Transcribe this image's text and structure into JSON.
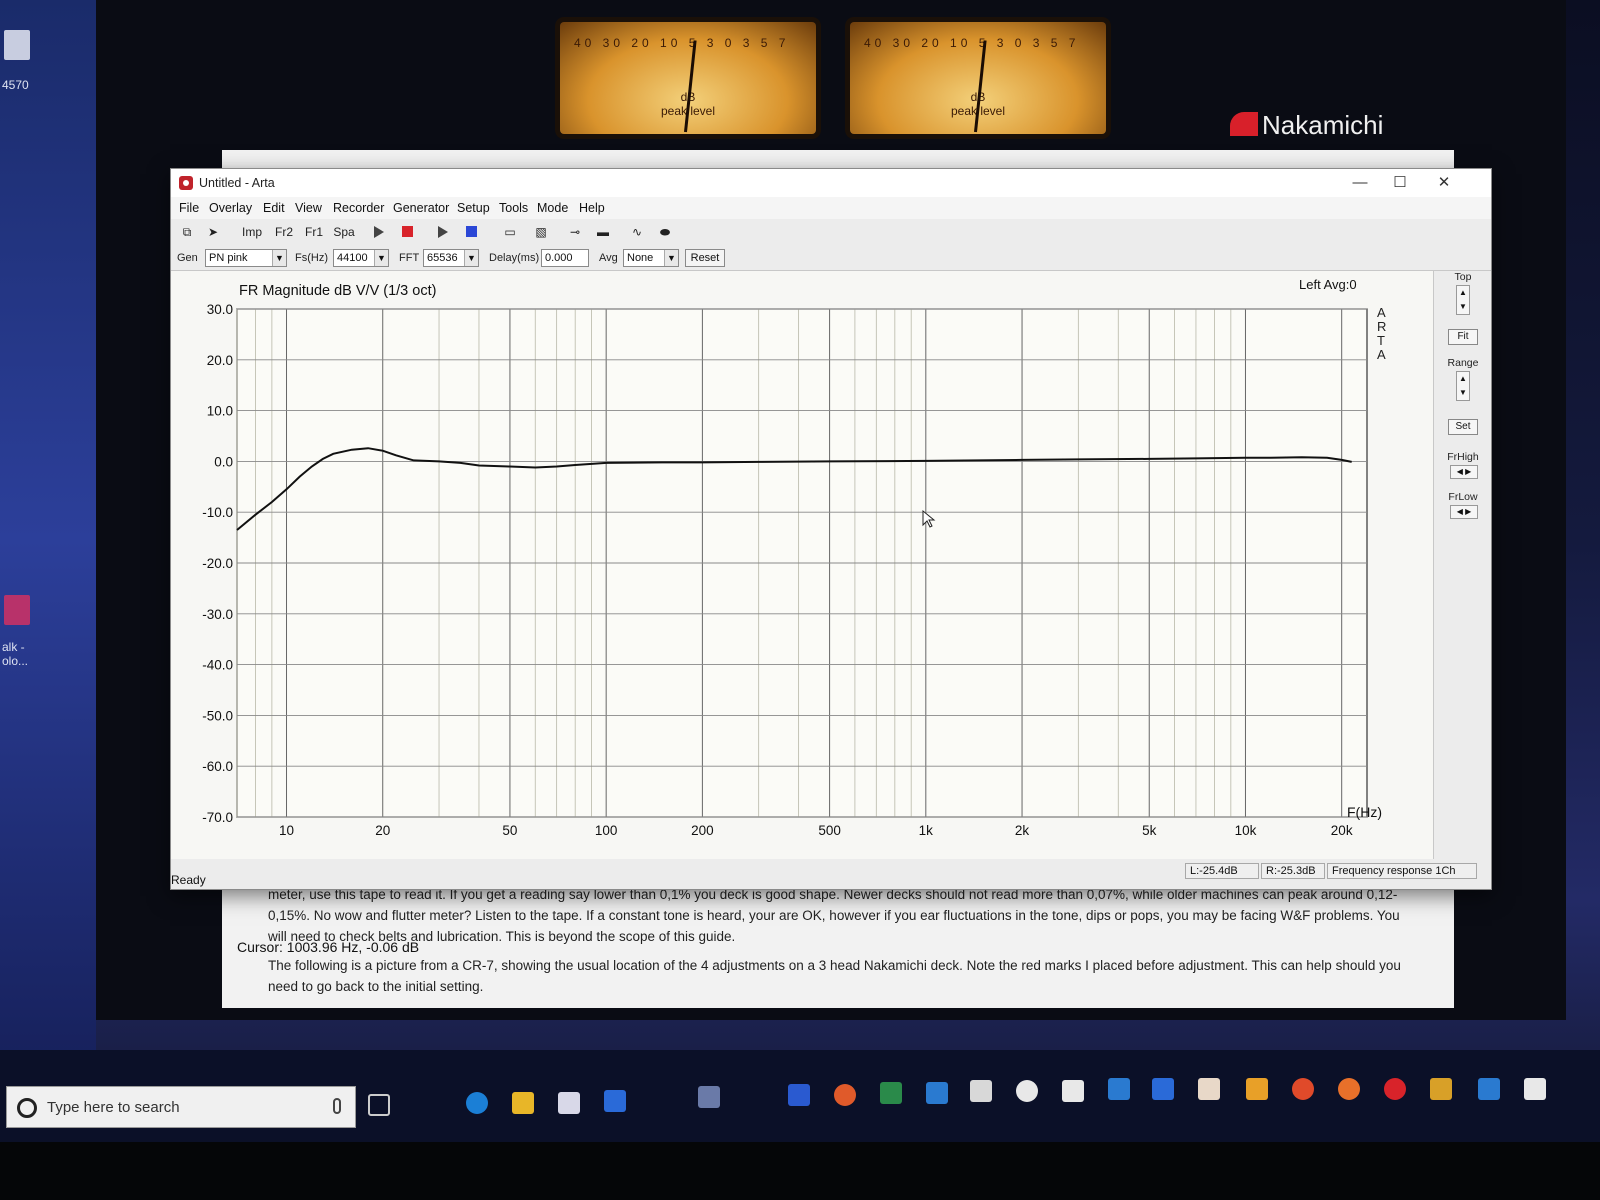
{
  "desktop": {
    "left_texts": [
      "4570",
      "alk -",
      "olo..."
    ]
  },
  "backdrop": {
    "brand": "Nakamichi",
    "vu_left": {
      "scale": "40 30 20 10 5 3 0 3 5 7",
      "db": "dB",
      "sub": "peak level"
    },
    "vu_right": {
      "scale": "40 30 20 10 5 3 0 3 5 7",
      "db": "dB",
      "sub": "peak level"
    }
  },
  "article": {
    "p1": "meter, use this tape to read it. If you get a reading say lower than 0,1% you deck is good shape. Newer decks should not read more than 0,07%, while older machines can peak around 0,12-0,15%. No wow and flutter meter? Listen to the tape. If a constant tone is heard, your are OK, however if you ear fluctuations in the tone, dips or pops, you may be facing W&F problems. You will need to check belts and lubrication. This is beyond the scope of this guide.",
    "p2": "The following is a picture from a CR-7, showing the usual location of the 4 adjustments on a 3 head Nakamichi deck. Note the red marks I placed before adjustment. This can help should you need to go back to the initial setting."
  },
  "window": {
    "title": "Untitled - Arta",
    "controls": {
      "minimize": "—",
      "maximize": "☐",
      "close": "✕"
    },
    "menu": [
      "File",
      "Overlay",
      "Edit",
      "View",
      "Recorder",
      "Generator",
      "Setup",
      "Tools",
      "Mode",
      "Help"
    ],
    "toolbar": {
      "imp": "Imp",
      "fr2": "Fr2",
      "fr1": "Fr1",
      "spa": "Spa"
    },
    "params": {
      "gen_label": "Gen",
      "gen_value": "PN pink",
      "fs_label": "Fs(Hz)",
      "fs_value": "44100",
      "fft_label": "FFT",
      "fft_value": "65536",
      "delay_label": "Delay(ms)",
      "delay_value": "0.000",
      "avg_label": "Avg",
      "avg_value": "None",
      "reset_label": "Reset"
    },
    "side": {
      "top": "Top",
      "fit": "Fit",
      "range": "Range",
      "set": "Set",
      "frhigh": "FrHigh",
      "frlow": "FrLow"
    },
    "cursor": "Cursor: 1003.96 Hz, -0.06 dB",
    "status": {
      "ready": "Ready",
      "l": "L:-25.4dB",
      "r": "R:-25.3dB",
      "mode": "Frequency response 1Ch"
    }
  },
  "chart_data": {
    "type": "line",
    "title": "FR Magnitude dB V/V (1/3 oct)",
    "channel_label": "Left  Avg:0",
    "watermark": "ARTA",
    "xlabel": "F(Hz)",
    "ylabel": "",
    "xscale": "log",
    "xlim": [
      7,
      24000
    ],
    "ylim": [
      -70,
      30
    ],
    "yticks": [
      "30.0",
      "20.0",
      "10.0",
      "0.0",
      "-10.0",
      "-20.0",
      "-30.0",
      "-40.0",
      "-50.0",
      "-60.0",
      "-70.0"
    ],
    "xticks": [
      {
        "v": 10,
        "label": "10"
      },
      {
        "v": 20,
        "label": "20"
      },
      {
        "v": 50,
        "label": "50"
      },
      {
        "v": 100,
        "label": "100"
      },
      {
        "v": 200,
        "label": "200"
      },
      {
        "v": 500,
        "label": "500"
      },
      {
        "v": 1000,
        "label": "1k"
      },
      {
        "v": 2000,
        "label": "2k"
      },
      {
        "v": 5000,
        "label": "5k"
      },
      {
        "v": 10000,
        "label": "10k"
      },
      {
        "v": 20000,
        "label": "20k"
      }
    ],
    "grid": true,
    "series": [
      {
        "x": [
          7,
          8,
          9,
          10,
          11,
          12,
          13,
          14,
          16,
          18,
          20,
          22,
          25,
          30,
          35,
          40,
          50,
          60,
          70,
          80,
          100,
          150,
          200,
          300,
          500,
          1000,
          2000,
          3000,
          5000,
          7000,
          10000,
          12000,
          15000,
          18000,
          20000,
          21500
        ],
        "y": [
          -13.5,
          -10.5,
          -8.0,
          -5.5,
          -3.0,
          -1.0,
          0.5,
          1.5,
          2.3,
          2.6,
          2.1,
          1.2,
          0.2,
          0.0,
          -0.3,
          -0.8,
          -1.0,
          -1.2,
          -1.0,
          -0.7,
          -0.3,
          -0.2,
          -0.2,
          -0.1,
          0.0,
          0.1,
          0.3,
          0.4,
          0.5,
          0.6,
          0.7,
          0.7,
          0.8,
          0.7,
          0.3,
          -0.1
        ],
        "color": "#111111"
      }
    ]
  }
}
